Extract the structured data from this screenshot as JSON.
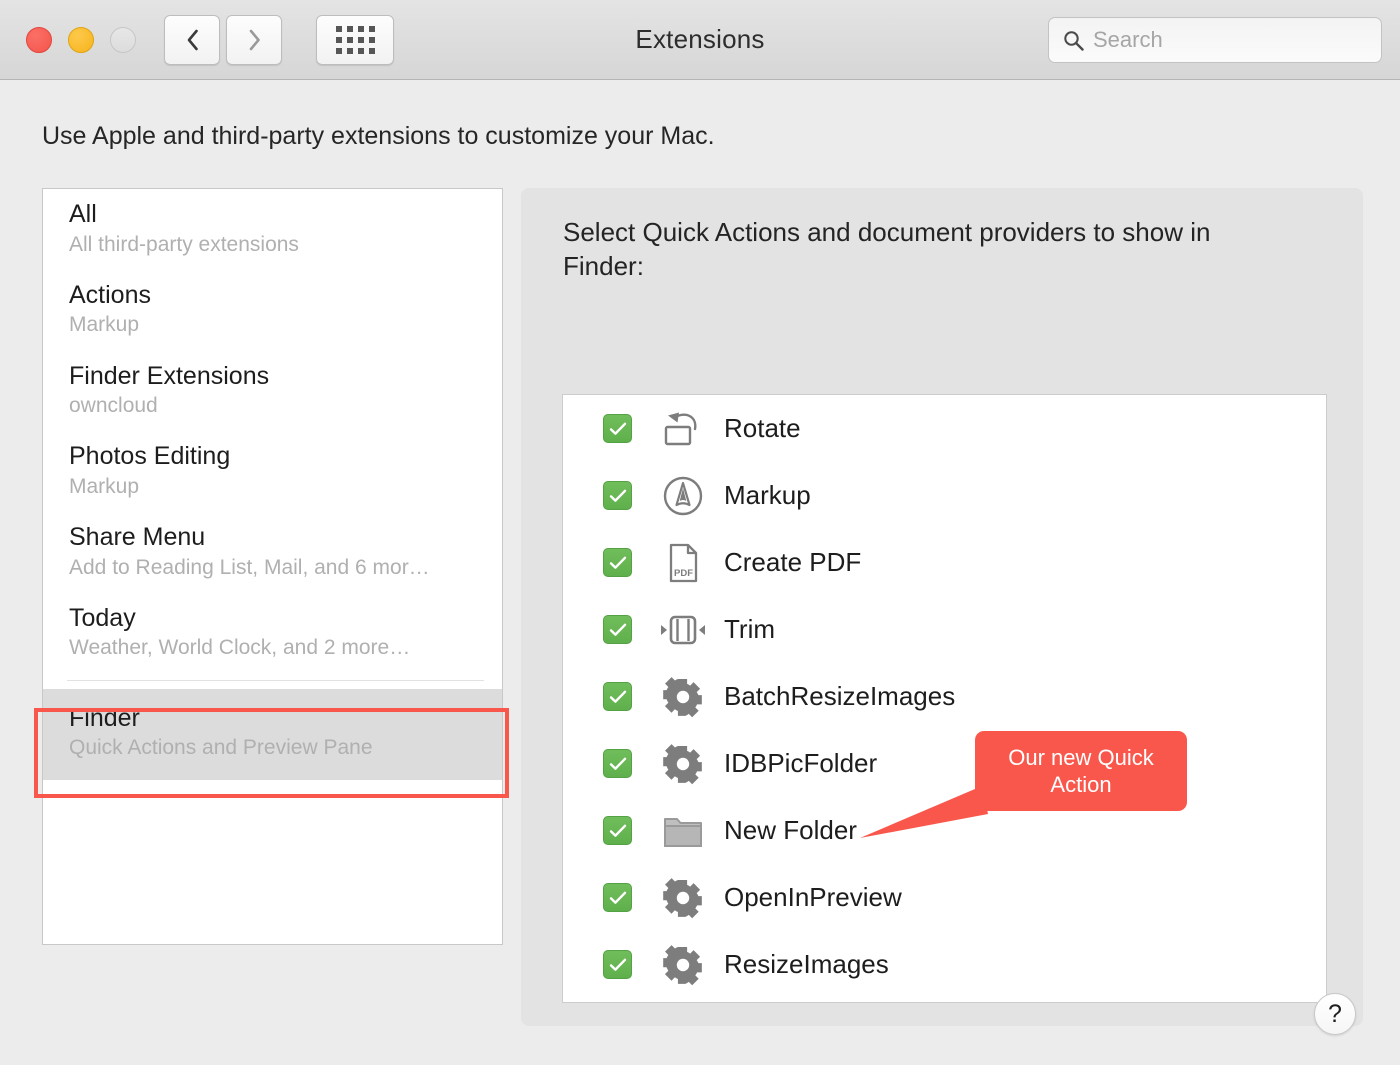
{
  "window": {
    "title": "Extensions",
    "traffic_lights": [
      "close",
      "minimize",
      "zoom"
    ],
    "nav": {
      "back_label": "‹",
      "forward_label": "›",
      "grid_label": "Show All"
    }
  },
  "search": {
    "placeholder": "Search",
    "value": ""
  },
  "intro": "Use Apple and third-party extensions to customize your Mac.",
  "sidebar": {
    "items": [
      {
        "title": "All",
        "subtitle": "All third-party extensions",
        "selected": false
      },
      {
        "title": "Actions",
        "subtitle": "Markup",
        "selected": false
      },
      {
        "title": "Finder Extensions",
        "subtitle": "owncloud",
        "selected": false
      },
      {
        "title": "Photos Editing",
        "subtitle": "Markup",
        "selected": false
      },
      {
        "title": "Share Menu",
        "subtitle": "Add to Reading List, Mail, and 6 mor…",
        "selected": false
      },
      {
        "title": "Today",
        "subtitle": "Weather, World Clock, and 2 more…",
        "selected": false
      },
      {
        "title": "Finder",
        "subtitle": "Quick Actions and Preview Pane",
        "selected": true
      }
    ]
  },
  "panel": {
    "heading": "Select Quick Actions and document providers to show in Finder:",
    "extensions": [
      {
        "label": "Rotate",
        "icon": "rotate-icon",
        "checked": true
      },
      {
        "label": "Markup",
        "icon": "markup-icon",
        "checked": true
      },
      {
        "label": "Create PDF",
        "icon": "pdf-icon",
        "checked": true
      },
      {
        "label": "Trim",
        "icon": "trim-icon",
        "checked": true
      },
      {
        "label": "BatchResizeImages",
        "icon": "gear-icon",
        "checked": true
      },
      {
        "label": "IDBPicFolder",
        "icon": "gear-icon",
        "checked": true
      },
      {
        "label": "New Folder",
        "icon": "folder-icon",
        "checked": true
      },
      {
        "label": "OpenInPreview",
        "icon": "gear-icon",
        "checked": true
      },
      {
        "label": "ResizeImages",
        "icon": "gear-icon",
        "checked": true
      }
    ]
  },
  "callout": {
    "text": "Our new Quick Action",
    "target": "New Folder"
  },
  "help": {
    "label": "?"
  },
  "colors": {
    "accent_red": "#f9574c",
    "checkbox_green": "#63b24f",
    "window_bg": "#ececec",
    "panel_bg": "#e3e3e3",
    "selected_row": "#dcdcdc"
  }
}
